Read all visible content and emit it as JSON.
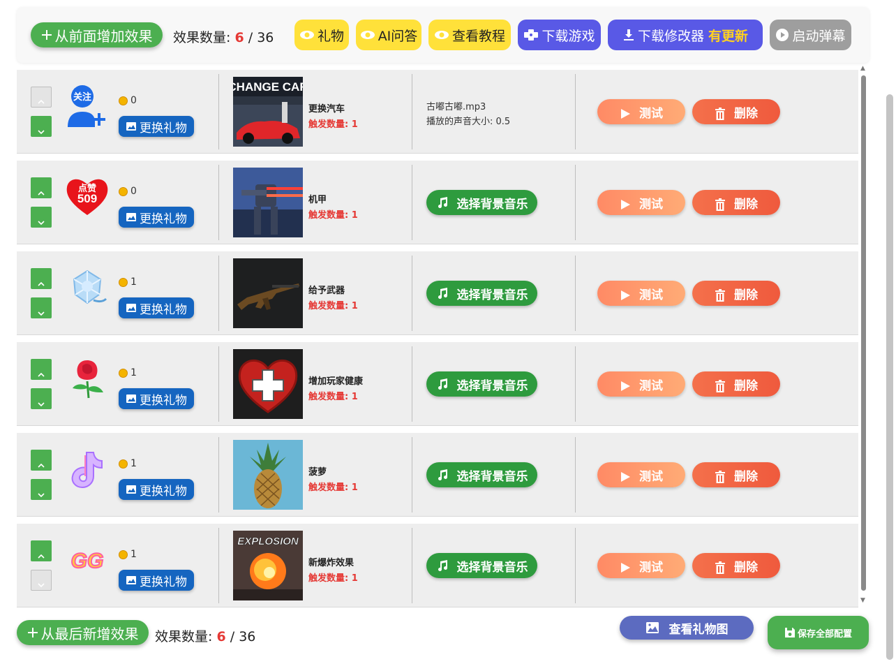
{
  "toolbar": {
    "add_front_label": "从前面增加效果",
    "count_label": "效果数量:",
    "count_current": "6",
    "count_sep": "/",
    "count_max": "36",
    "gift_label": "礼物",
    "ai_label": "AI问答",
    "tutorial_label": "查看教程",
    "download_game_label": "下载游戏",
    "download_modifier_label": "下载修改器",
    "update_label": "有更新",
    "barrage_label": "启动弹幕"
  },
  "rows": [
    {
      "gift": "follow",
      "gift_text": "关注",
      "coins": "0",
      "change_label": "更换礼物",
      "effect_name": "更换汽车",
      "trigger_label": "触发数量:",
      "trigger_count": "1",
      "image_caption": "CHANGE CAR",
      "music_file": "古嘟古嘟.mp3",
      "music_volume": "播放的声音大小: 0.5",
      "test_label": "测试",
      "delete_label": "删除",
      "up_checked": false,
      "down_checked": true
    },
    {
      "gift": "like",
      "gift_text": "点赞",
      "gift_num": "509",
      "coins": "0",
      "change_label": "更换礼物",
      "effect_name": "机甲",
      "trigger_label": "触发数量:",
      "trigger_count": "1",
      "music_label": "选择背景音乐",
      "test_label": "测试",
      "delete_label": "删除",
      "up_checked": true,
      "down_checked": true
    },
    {
      "gift": "ice-rose",
      "coins": "1",
      "change_label": "更换礼物",
      "effect_name": "给予武器",
      "trigger_label": "触发数量:",
      "trigger_count": "1",
      "music_label": "选择背景音乐",
      "test_label": "测试",
      "delete_label": "删除",
      "up_checked": true,
      "down_checked": true
    },
    {
      "gift": "rose",
      "coins": "1",
      "change_label": "更换礼物",
      "effect_name": "增加玩家健康",
      "trigger_label": "触发数量:",
      "trigger_count": "1",
      "music_label": "选择背景音乐",
      "test_label": "测试",
      "delete_label": "删除",
      "up_checked": true,
      "down_checked": true
    },
    {
      "gift": "tiktok",
      "coins": "1",
      "change_label": "更换礼物",
      "effect_name": "菠萝",
      "trigger_label": "触发数量:",
      "trigger_count": "1",
      "music_label": "选择背景音乐",
      "test_label": "测试",
      "delete_label": "删除",
      "up_checked": true,
      "down_checked": true
    },
    {
      "gift": "gg",
      "gift_text": "GG",
      "coins": "1",
      "change_label": "更换礼物",
      "effect_name": "新爆炸效果",
      "trigger_label": "触发数量:",
      "trigger_count": "1",
      "image_caption": "EXPLOSION",
      "music_label": "选择背景音乐",
      "test_label": "测试",
      "delete_label": "删除",
      "up_checked": true,
      "down_checked": false
    }
  ],
  "bottom": {
    "add_back_label": "从最后新增效果",
    "count_label": "效果数量:",
    "count_current": "6",
    "count_sep": "/",
    "count_max": "36",
    "gallery_label": "查看礼物图",
    "save_label": "保存全部配置"
  },
  "colors": {
    "green": "#4caf50",
    "blue": "#1565c0",
    "yellow": "#ffe13a",
    "purple": "#5959e6",
    "red": "#e53935"
  }
}
